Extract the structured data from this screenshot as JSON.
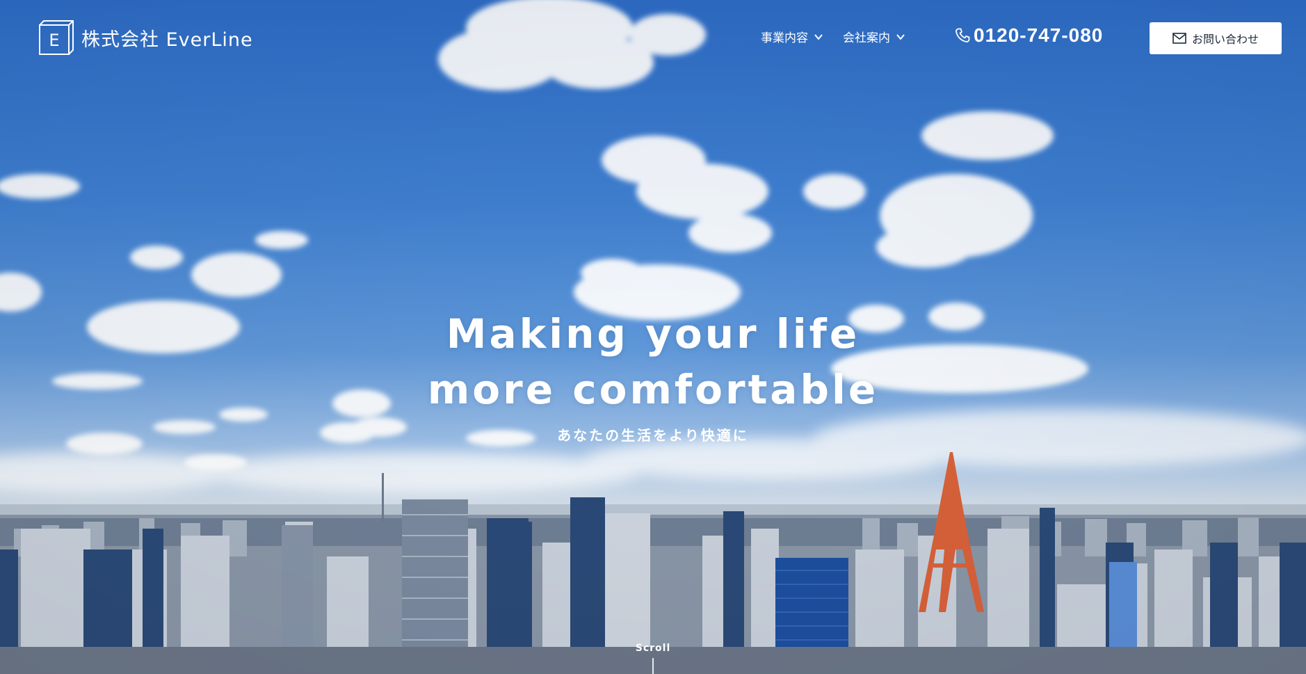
{
  "header": {
    "logo_text": "株式会社 EverLine",
    "logo_letter": "E",
    "nav": [
      {
        "label": "事業内容",
        "icon": "chevron-down-icon"
      },
      {
        "label": "会社案内",
        "icon": "chevron-down-icon"
      }
    ],
    "phone": {
      "icon": "phone-icon",
      "number": "0120-747-080"
    },
    "contact_button": {
      "icon": "mail-icon",
      "label": "お問い合わせ"
    }
  },
  "hero": {
    "title_line1": "Making your life",
    "title_line2": "more comfortable",
    "subtitle": "あなたの生活をより快適に",
    "background": "tokyo-skyline-blue-sky-photo"
  },
  "scroll": {
    "label": "Scroll"
  },
  "colors": {
    "sky_top": "#2d6cc6",
    "white": "#ffffff",
    "button_text": "#1e2a3a",
    "tower": "#d9623a"
  }
}
